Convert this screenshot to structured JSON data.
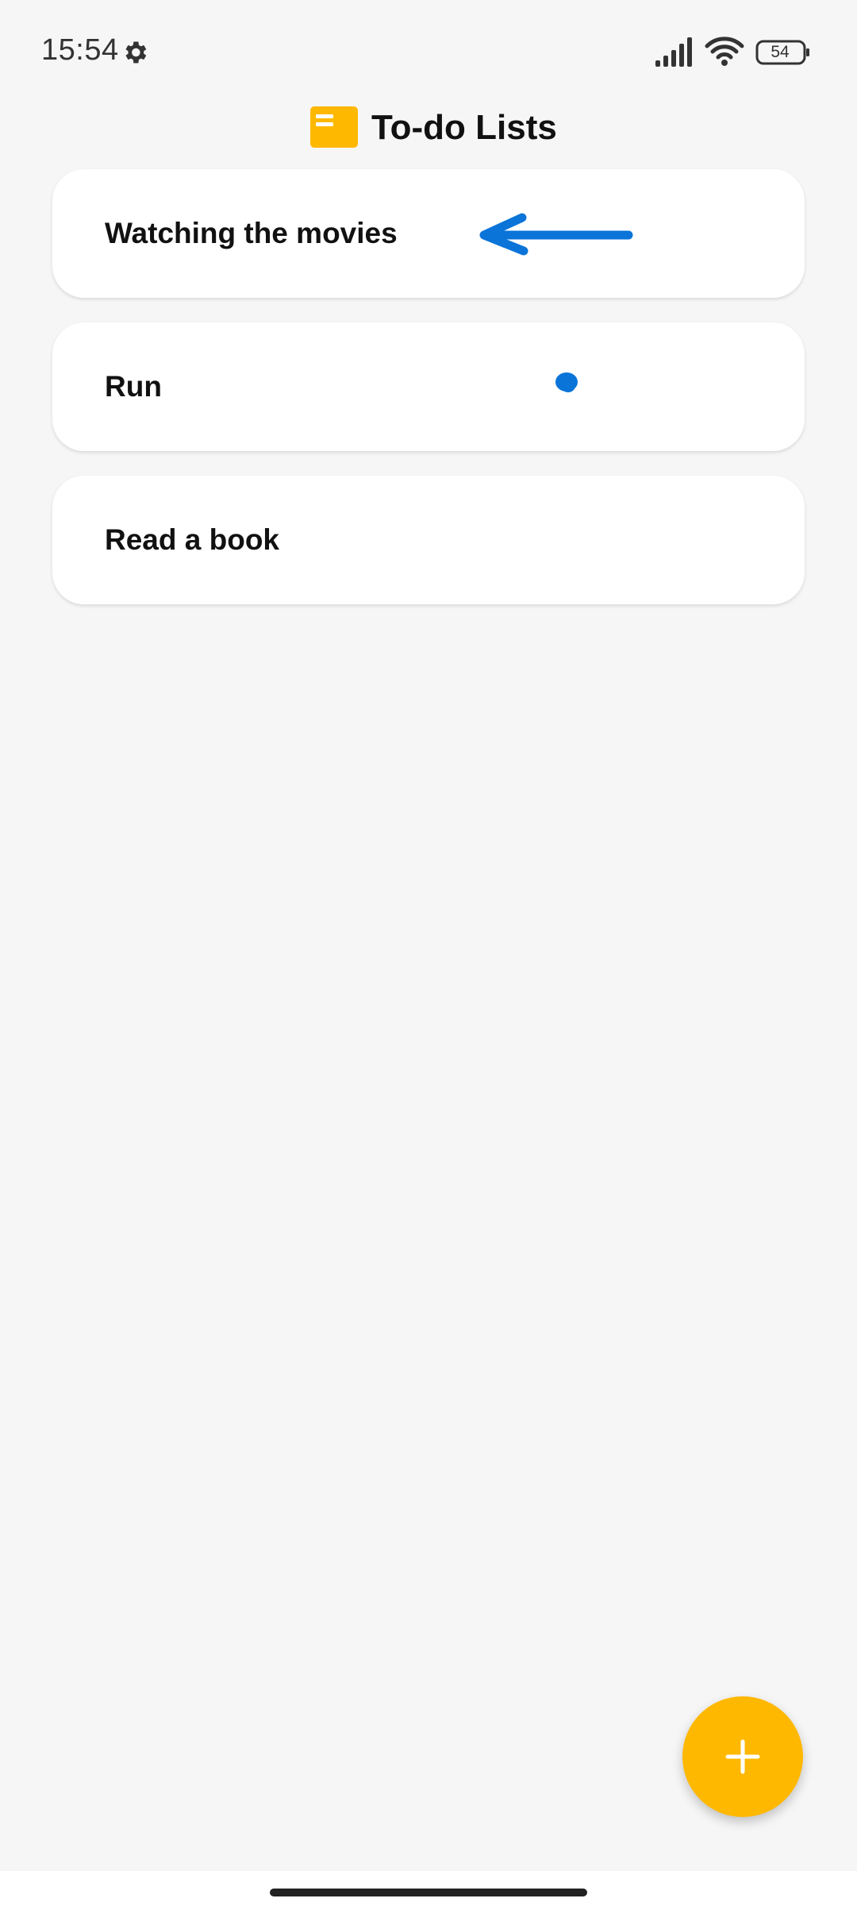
{
  "status_bar": {
    "time": "15:54",
    "battery_level": "54",
    "icons": [
      "gear-icon",
      "signal-icon",
      "wifi-icon",
      "battery-icon"
    ]
  },
  "header": {
    "title": "To-do Lists",
    "icon": "notes-icon"
  },
  "todos": [
    {
      "label": "Watching the movies"
    },
    {
      "label": "Run"
    },
    {
      "label": "Read a book"
    }
  ],
  "fab": {
    "icon": "plus-icon"
  },
  "colors": {
    "accent": "#ffb800",
    "background": "#f6f6f6",
    "card": "#ffffff",
    "annotation": "#0a74d8"
  }
}
